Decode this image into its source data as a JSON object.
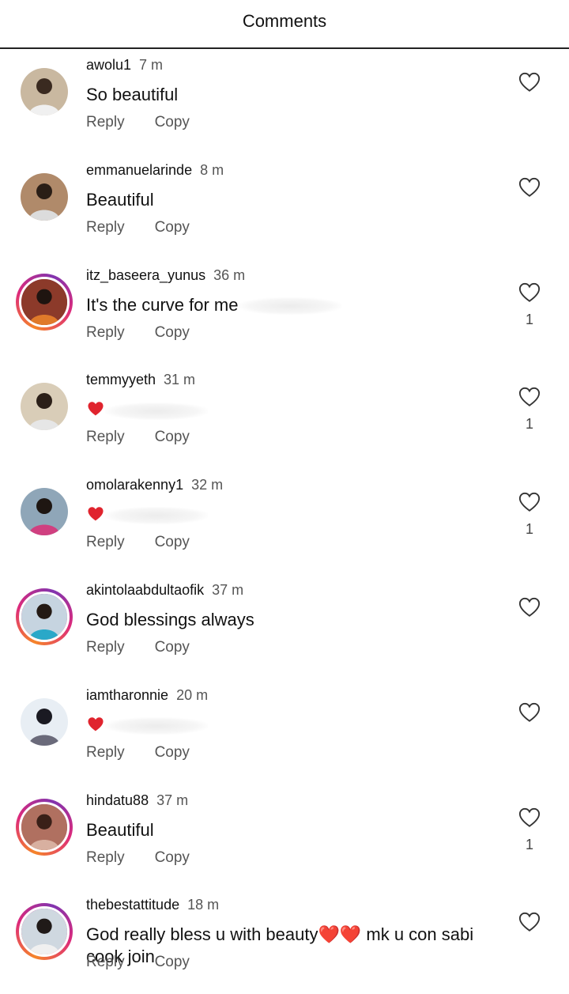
{
  "header": {
    "title": "Comments"
  },
  "actions": {
    "reply": "Reply",
    "copy": "Copy"
  },
  "comments": [
    {
      "username": "awolu1",
      "time": "7 m",
      "text": "So beautiful",
      "likes": "",
      "ring": false,
      "emoji": false,
      "blur": false
    },
    {
      "username": "emmanuelarinde",
      "time": "8 m",
      "text": "Beautiful",
      "likes": "",
      "ring": false,
      "emoji": false,
      "blur": false
    },
    {
      "username": "itz_baseera_yunus",
      "time": "36 m",
      "text": "It's the curve  for me",
      "likes": "1",
      "ring": true,
      "emoji": false,
      "blur": true
    },
    {
      "username": "temmyyeth",
      "time": "31 m",
      "text": "",
      "likes": "1",
      "ring": false,
      "emoji": true,
      "blur": true
    },
    {
      "username": "omolarakenny1",
      "time": "32 m",
      "text": "",
      "likes": "1",
      "ring": false,
      "emoji": true,
      "blur": true
    },
    {
      "username": "akintolaabdultaofik",
      "time": "37 m",
      "text": "God blessings always",
      "likes": "",
      "ring": true,
      "emoji": false,
      "blur": false
    },
    {
      "username": "iamtharonnie",
      "time": "20 m",
      "text": "",
      "likes": "",
      "ring": false,
      "emoji": true,
      "blur": true
    },
    {
      "username": "hindatu88",
      "time": "37 m",
      "text": "Beautiful",
      "likes": "1",
      "ring": true,
      "emoji": false,
      "blur": false
    },
    {
      "username": "thebestattitude",
      "time": "18 m",
      "text": "God really bless u with beauty❤️❤️ mk u con sabi cook join",
      "likes": "",
      "ring": true,
      "emoji": false,
      "blur": false
    }
  ],
  "colors": {
    "heart": "#e0242e",
    "ring_start": "#f58529",
    "ring_end": "#dd2a7b"
  },
  "icons": {
    "like": "heart-outline-icon",
    "emoji": "red-heart-emoji"
  }
}
